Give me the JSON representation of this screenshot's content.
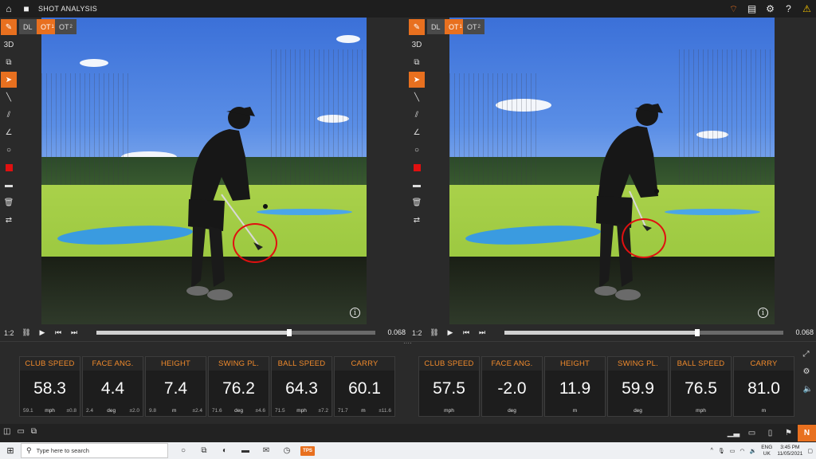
{
  "app": {
    "title": "SHOT ANALYSIS",
    "accent": "#e8701f",
    "label_color": "#f08a2c"
  },
  "titlebar_icons": [
    "home-icon",
    "folder-icon"
  ],
  "titlebar_right_icons": [
    "logo-icon",
    "report-icon",
    "settings-icon",
    "help-icon",
    "warning-icon"
  ],
  "titlebar_right_glyphs": [
    "⌔",
    "▤",
    "⚙",
    "?",
    "⚠"
  ],
  "panes": [
    {
      "tabs": [
        {
          "label": "DL",
          "sub": "",
          "active": false
        },
        {
          "label": "OT",
          "sub": "1",
          "active": true
        },
        {
          "label": "OT",
          "sub": "2",
          "active": false
        }
      ],
      "ratio": "1:2",
      "time": "0.068",
      "progress": 0.69
    },
    {
      "tabs": [
        {
          "label": "DL",
          "sub": "",
          "active": false
        },
        {
          "label": "OT",
          "sub": "1",
          "active": true
        },
        {
          "label": "OT",
          "sub": "2",
          "active": false
        }
      ],
      "ratio": "1:2",
      "time": "0.068",
      "progress": 0.69
    }
  ],
  "tools": {
    "three_d": "3D"
  },
  "metrics_left": [
    {
      "label": "CLUB SPEED",
      "value": "58.3",
      "min": "59.1",
      "unit": "mph",
      "dev": "±0.8"
    },
    {
      "label": "FACE ANG.",
      "value": "4.4",
      "min": "2.4",
      "unit": "deg",
      "dev": "±2.0"
    },
    {
      "label": "HEIGHT",
      "value": "7.4",
      "min": "9.8",
      "unit": "m",
      "dev": "±2.4"
    },
    {
      "label": "SWING PL.",
      "value": "76.2",
      "min": "71.6",
      "unit": "deg",
      "dev": "±4.6"
    },
    {
      "label": "BALL SPEED",
      "value": "64.3",
      "min": "71.5",
      "unit": "mph",
      "dev": "±7.2"
    },
    {
      "label": "CARRY",
      "value": "60.1",
      "min": "71.7",
      "unit": "m",
      "dev": "±11.6"
    }
  ],
  "metrics_right": [
    {
      "label": "CLUB SPEED",
      "value": "57.5",
      "min": "",
      "unit": "mph",
      "dev": ""
    },
    {
      "label": "FACE ANG.",
      "value": "-2.0",
      "min": "",
      "unit": "deg",
      "dev": ""
    },
    {
      "label": "HEIGHT",
      "value": "11.9",
      "min": "",
      "unit": "m",
      "dev": ""
    },
    {
      "label": "SWING PL.",
      "value": "59.9",
      "min": "",
      "unit": "deg",
      "dev": ""
    },
    {
      "label": "BALL SPEED",
      "value": "76.5",
      "min": "",
      "unit": "mph",
      "dev": ""
    },
    {
      "label": "CARRY",
      "value": "81.0",
      "min": "",
      "unit": "m",
      "dev": ""
    }
  ],
  "bottom_right": {
    "n_label": "N"
  },
  "taskbar": {
    "search_placeholder": "Type here to search",
    "app_badge": "TPS",
    "lang_top": "ENG",
    "lang_bottom": "UK",
    "time": "3:45 PM",
    "date": "11/05/2021"
  }
}
